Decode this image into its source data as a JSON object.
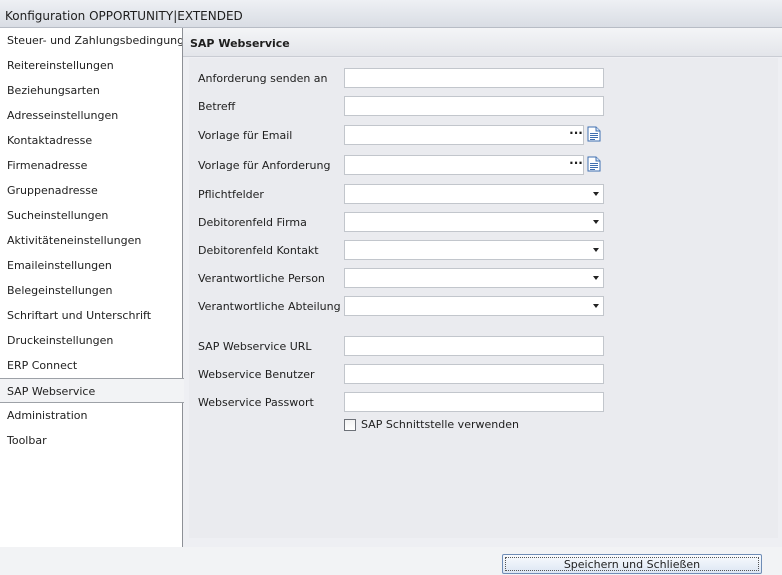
{
  "window": {
    "title": "Konfiguration OPPORTUNITY|EXTENDED"
  },
  "sidebar": {
    "items": [
      {
        "label": "Steuer- und Zahlungsbedingungen"
      },
      {
        "label": "Reitereinstellungen"
      },
      {
        "label": "Beziehungsarten"
      },
      {
        "label": "Adresseinstellungen"
      },
      {
        "label": "Kontaktadresse"
      },
      {
        "label": "Firmenadresse"
      },
      {
        "label": "Gruppenadresse"
      },
      {
        "label": "Sucheinstellungen"
      },
      {
        "label": "Aktivitäteneinstellungen"
      },
      {
        "label": "Emaileinstellungen"
      },
      {
        "label": "Belegeinstellungen"
      },
      {
        "label": "Schriftart und Unterschrift"
      },
      {
        "label": "Druckeinstellungen"
      },
      {
        "label": "ERP Connect"
      },
      {
        "label": "SAP Webservice",
        "active": true
      },
      {
        "label": "Administration"
      },
      {
        "label": "Toolbar"
      }
    ]
  },
  "section": {
    "title": "SAP Webservice"
  },
  "form": {
    "anforderung_senden_an": {
      "label": "Anforderung senden an",
      "value": ""
    },
    "betreff": {
      "label": "Betreff",
      "value": ""
    },
    "vorlage_email": {
      "label": "Vorlage für Email",
      "value": "",
      "browse_label": "···",
      "icon": "document-icon"
    },
    "vorlage_anforderung": {
      "label": "Vorlage für Anforderung",
      "value": "",
      "browse_label": "···",
      "icon": "document-icon"
    },
    "pflichtfelder": {
      "label": "Pflichtfelder",
      "value": ""
    },
    "debitorenfeld_firma": {
      "label": "Debitorenfeld Firma",
      "value": ""
    },
    "debitorenfeld_kontakt": {
      "label": "Debitorenfeld Kontakt",
      "value": ""
    },
    "verantwortliche_person": {
      "label": "Verantwortliche Person",
      "value": ""
    },
    "verantwortliche_abteilung": {
      "label": "Verantwortliche Abteilung",
      "value": ""
    },
    "sap_webservice_url": {
      "label": "SAP Webservice URL",
      "value": ""
    },
    "webservice_benutzer": {
      "label": "Webservice Benutzer",
      "value": ""
    },
    "webservice_passwort": {
      "label": "Webservice Passwort",
      "value": ""
    },
    "sap_schnittstelle": {
      "label": "SAP Schnittstelle verwenden",
      "checked": false
    }
  },
  "footer": {
    "save_label": "Speichern und Schließen"
  },
  "colors": {
    "titlebar_bg": "#dde1e8",
    "sidebar_bg": "#ffffff",
    "content_bg": "#eeeff3",
    "field_border": "#c2c6cc",
    "button_border": "#6f8db6"
  }
}
